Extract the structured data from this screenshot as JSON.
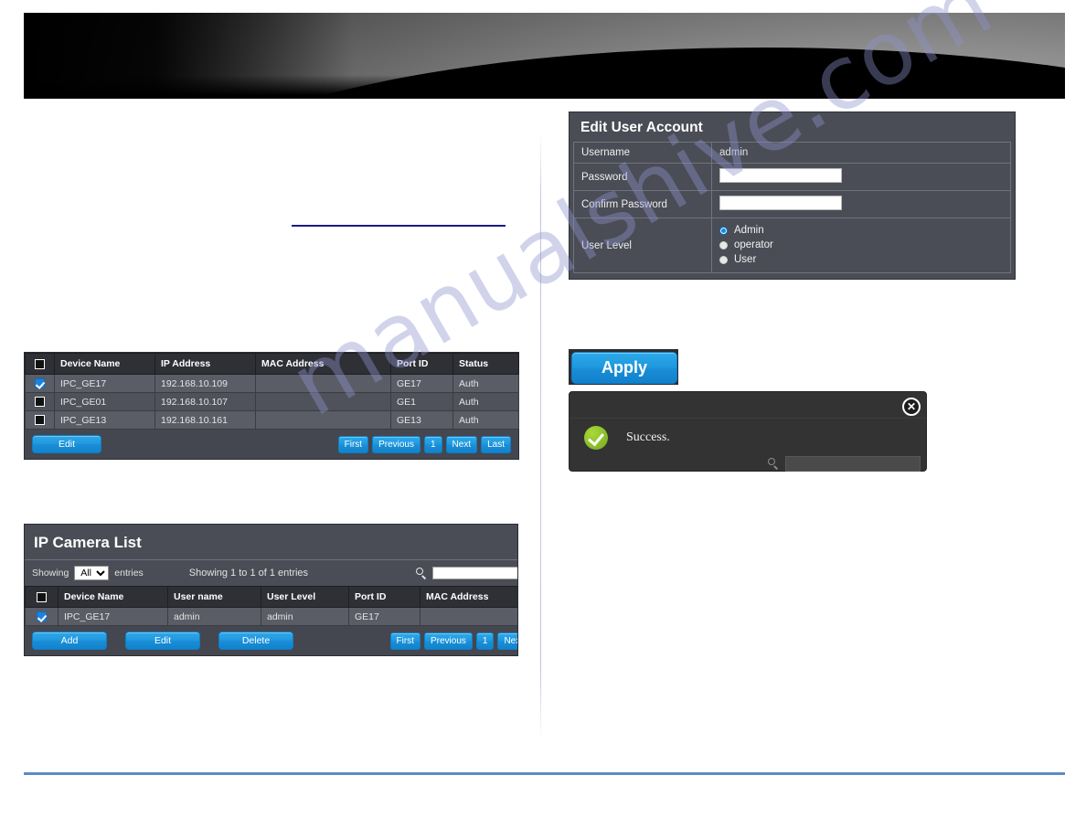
{
  "banner": {
    "alt": "product-banner-graphic"
  },
  "watermark": {
    "text": "manualshive.com"
  },
  "edit_user_card": {
    "title": "Edit User Account",
    "rows": {
      "username_label": "Username",
      "username_value": "admin",
      "password_label": "Password",
      "password_value": "",
      "confirm_password_label": "Confirm Password",
      "confirm_password_value": "",
      "user_level_label": "User Level"
    },
    "user_levels": [
      {
        "label": "Admin",
        "selected": true
      },
      {
        "label": "operator",
        "selected": false
      },
      {
        "label": "User",
        "selected": false
      }
    ]
  },
  "apply": {
    "label": "Apply"
  },
  "success_dialog": {
    "message": "Success.",
    "close_label": "✕",
    "search_value": ""
  },
  "device_table": {
    "columns": [
      "",
      "Device Name",
      "IP Address",
      "MAC Address",
      "Port ID",
      "Status"
    ],
    "rows": [
      {
        "checked": true,
        "device_name": "IPC_GE17",
        "ip_address": "192.168.10.109",
        "mac_address": "",
        "port_id": "GE17",
        "status": "Auth"
      },
      {
        "checked": false,
        "device_name": "IPC_GE01",
        "ip_address": "192.168.10.107",
        "mac_address": "",
        "port_id": "GE1",
        "status": "Auth"
      },
      {
        "checked": false,
        "device_name": "IPC_GE13",
        "ip_address": "192.168.10.161",
        "mac_address": "",
        "port_id": "GE13",
        "status": "Auth"
      }
    ],
    "edit_label": "Edit",
    "pagination": [
      "First",
      "Previous",
      "1",
      "Next",
      "Last"
    ]
  },
  "ipcam_list": {
    "title": "IP Camera List",
    "showing_prefix": "Showing",
    "entries_select_value": "All",
    "entries_suffix": "entries",
    "showing_info": "Showing 1 to 1 of 1 entries",
    "search_value": "",
    "columns": [
      "",
      "Device Name",
      "User name",
      "User Level",
      "Port ID",
      "MAC Address"
    ],
    "rows": [
      {
        "checked": true,
        "device_name": "IPC_GE17",
        "user_name": "admin",
        "user_level": "admin",
        "port_id": "GE17",
        "mac_address": ""
      }
    ],
    "buttons": [
      "Add",
      "Edit",
      "Delete"
    ],
    "pagination": [
      "First",
      "Previous",
      "1",
      "Next"
    ]
  },
  "colors": {
    "accent_blue": "#1a8ed6",
    "panel_dark": "#4a4d55",
    "header_dark": "#2e3036",
    "success_green": "#8cc02a",
    "rule_blue": "#5b8bc4",
    "link_blue": "#1b1b87"
  }
}
